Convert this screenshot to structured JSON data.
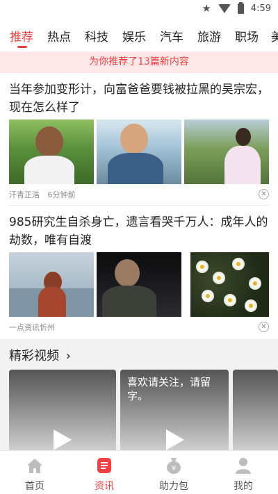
{
  "status_bar": {
    "time": "4:59"
  },
  "tabs": [
    "推荐",
    "热点",
    "科技",
    "娱乐",
    "汽车",
    "旅游",
    "职场",
    "美"
  ],
  "banner": {
    "text": "为你推荐了13篇新内容"
  },
  "articles": [
    {
      "title": "当年参加变形计，向富爸爸要钱被拉黑的吴宗宏，现在怎么样了",
      "source": "汗青正浩",
      "time": "6分钟前"
    },
    {
      "title": "985研究生自杀身亡，遗言看哭千万人：成年人的劫数，唯有自渡",
      "source": "一点资讯忻州",
      "time": ""
    }
  ],
  "video_section": {
    "title": "精彩视频",
    "chevron": "chevron-right-icon",
    "cards": [
      {
        "caption": ""
      },
      {
        "caption": "喜欢请关注，请留字。"
      },
      {
        "caption": ""
      }
    ]
  },
  "bottom_nav": [
    {
      "label": "首页",
      "icon": "home-icon"
    },
    {
      "label": "资讯",
      "icon": "news-icon"
    },
    {
      "label": "助力包",
      "icon": "money-bag-icon"
    },
    {
      "label": "我的",
      "icon": "profile-icon"
    }
  ],
  "colors": {
    "accent": "#f04142",
    "banner_bg": "#fde7e8",
    "icon_gray": "#bdbdbd"
  }
}
